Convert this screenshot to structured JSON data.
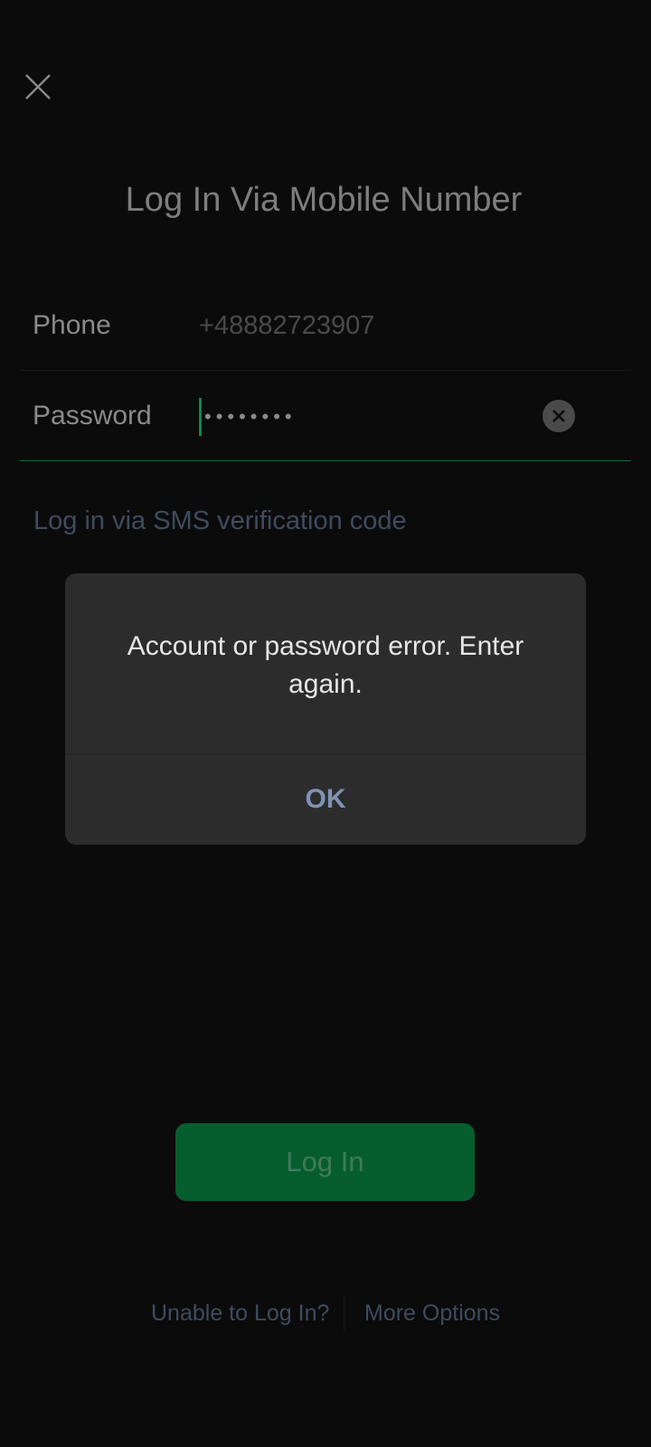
{
  "header": {
    "close_icon": "close-icon",
    "title": "Log In Via Mobile Number"
  },
  "form": {
    "phone_label": "Phone",
    "phone_value": "+48882723907",
    "password_label": "Password",
    "password_masked": "••••••••",
    "clear_icon": "clear-circle-icon",
    "sms_link": "Log in via SMS verification code"
  },
  "dialog": {
    "message": "Account or password error. Enter again.",
    "ok_label": "OK"
  },
  "login_button": "Log In",
  "footer": {
    "unable_label": "Unable to Log In?",
    "more_label": "More Options"
  },
  "colors": {
    "background": "#0b0b0b",
    "accent_green": "#065e2f",
    "dialog_bg": "#2c2c2c",
    "link_blue": "#3f4b5e",
    "ok_blue": "#8093b3"
  }
}
